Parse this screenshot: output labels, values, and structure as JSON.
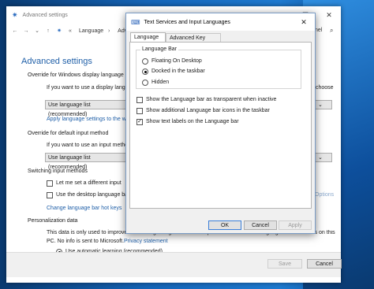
{
  "background_window": {
    "title": "Advanced settings",
    "address_crumbs": [
      "Language",
      "Advanced"
    ],
    "search_fragment": "nel",
    "heading": "Advanced settings",
    "override_display": {
      "label": "Override for Windows display language",
      "desc": "If you want to use a display language",
      "desc_suffix": "choose",
      "select_value": "Use language list (recommended)",
      "link": "Apply language settings to the w"
    },
    "override_input": {
      "label": "Override for default input method",
      "desc": "If you want to use an input method",
      "select_value": "Use language list (recommended)"
    },
    "switching": {
      "label": "Switching input methods",
      "opt1": "Let me set a different input",
      "opt2": "Use the desktop language bar",
      "options_link": "Options",
      "hotkeys_link": "Change language bar hot keys"
    },
    "personalization": {
      "label": "Personalization data",
      "line1": "This data is only used to improve",
      "line1_suffix": "handwriting recognition and text prediction results for languages without IMEs on this",
      "line2": "PC. No info is sent to Microsoft.",
      "privacy_link": "Privacy statement",
      "radio_label": "Use automatic learning (recommended)"
    },
    "save_label": "Save",
    "cancel_label": "Cancel"
  },
  "dialog": {
    "title": "Text Services and Input Languages",
    "tabs": [
      "Language Bar",
      "Advanced Key Settings"
    ],
    "group_label": "Language Bar",
    "radios": [
      {
        "label": "Floating On Desktop",
        "checked": false
      },
      {
        "label": "Docked in the taskbar",
        "checked": true
      },
      {
        "label": "Hidden",
        "checked": false
      }
    ],
    "checks": [
      {
        "label": "Show the Language bar as transparent when inactive",
        "checked": false
      },
      {
        "label": "Show additional Language bar icons in the taskbar",
        "checked": false
      },
      {
        "label": "Show text labels on the Language bar",
        "checked": true
      }
    ],
    "ok_label": "OK",
    "cancel_label": "Cancel",
    "apply_label": "Apply"
  }
}
